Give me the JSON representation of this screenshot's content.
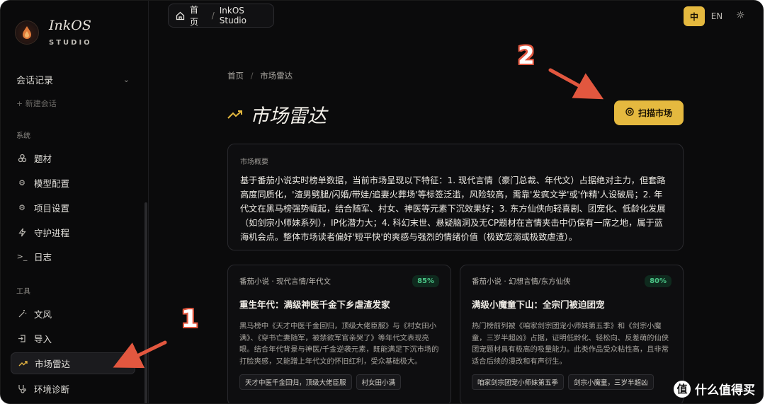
{
  "app": {
    "name": "InkOS",
    "sub": "STUDIO"
  },
  "sidebar": {
    "sessions_label": "会话记录",
    "new_session": "+ 新建会话",
    "system_label": "系统",
    "system_items": [
      {
        "label": "题材",
        "icon": "gears-icon"
      },
      {
        "label": "模型配置",
        "icon": "gear-icon"
      },
      {
        "label": "项目设置",
        "icon": "gear-icon"
      },
      {
        "label": "守护进程",
        "icon": "bolt-icon"
      },
      {
        "label": "日志",
        "icon": "terminal-icon"
      }
    ],
    "tools_label": "工具",
    "tool_items": [
      {
        "label": "文风",
        "icon": "wand-icon"
      },
      {
        "label": "导入",
        "icon": "import-icon"
      },
      {
        "label": "市场雷达",
        "icon": "trend-icon"
      },
      {
        "label": "环境诊断",
        "icon": "stethoscope-icon"
      }
    ]
  },
  "topbar": {
    "crumb_home": "首页",
    "crumb_current": "InkOS Studio",
    "lang_zh": "中",
    "lang_en": "EN"
  },
  "main": {
    "breadcrumb_home": "首页",
    "breadcrumb_current": "市场雷达",
    "title": "市场雷达",
    "scan_button": "扫描市场",
    "overview_label": "市场概要",
    "overview_text": "基于番茄小说实时榜单数据，当前市场呈现以下特征：1. 现代言情（豪门总裁、年代文）占据绝对主力，但套路高度同质化，'渣男劈腿/闪婚/带娃/追妻火葬场'等标签泛滥，风险较高，需靠'发疯文学'或'作精'人设破局；2. 年代文在黑马榜强势崛起，结合随军、村女、神医等元素下沉效果好；3. 东方仙侠向轻喜剧、团宠化、低龄化发展（如剑宗小师妹系列），IP化潜力大；4. 科幻末世、悬疑脑洞及无CP题材在言情夹击中仍保有一席之地，属于蓝海机会点。整体市场读者偏好'短平快'的爽感与强烈的情绪价值（极致宠溺或极致虐渣）。",
    "cards": [
      {
        "category": "番茄小说 · 现代言情/年代文",
        "percent": "85%",
        "title": "重生年代：满级神医千金下乡虐渣发家",
        "desc": "黑马榜中《天才中医千金回归，顶级大佬臣服》与《村女田小满》、《穿书亡妻随军，被禁欲军官亲哭了》等年代文表现亮眼。结合年代背景与神医/千金逆袭元素，既能满足下沉市场的打脸爽感，又能蹭上年代文的怀旧红利，受众基础极大。",
        "tags": [
          "天才中医千金回归，顶级大佬臣服",
          "村女田小满"
        ]
      },
      {
        "category": "番茄小说 · 幻想言情/东方仙侠",
        "percent": "80%",
        "title": "满级小魔童下山：全宗门被迫团宠",
        "desc": "热门榜前列被《咱家剑宗团宠小师妹第五季》和《剑宗小魔童，三岁半超凶》占据，证明低龄化、轻松向、反差萌的仙侠团宠题材具有极高的吸量能力。此类作品受众粘性高，且非常适合后续的漫改和有声衍生。",
        "tags": [
          "咱家剑宗团宠小师妹第五季",
          "剑宗小魔童，三岁半超凶"
        ]
      }
    ]
  },
  "annotations": {
    "num1": "1",
    "num2": "2"
  },
  "watermark": {
    "badge": "值",
    "text": "什么值得买"
  },
  "colors": {
    "accent": "#e5b93f",
    "annotation": "#e2573f",
    "success": "#4ac486"
  }
}
